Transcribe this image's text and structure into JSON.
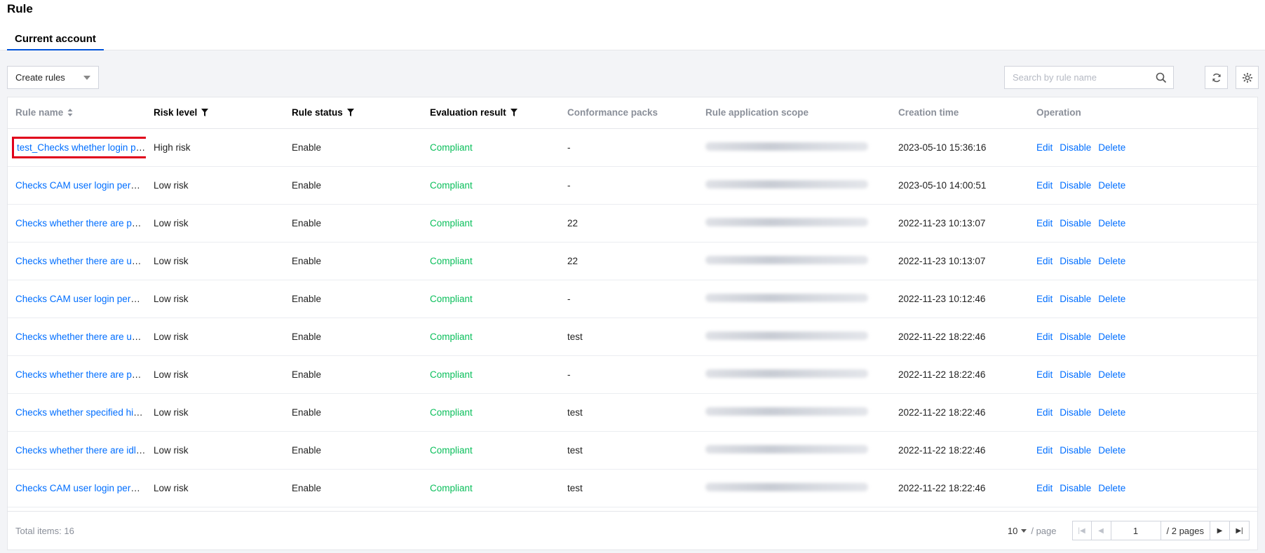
{
  "page": {
    "title": "Rule"
  },
  "tabs": [
    {
      "label": "Current account",
      "active": true
    }
  ],
  "toolbar": {
    "create_label": "Create rules",
    "search_placeholder": "Search by rule name"
  },
  "table": {
    "headers": {
      "rule_name": "Rule name",
      "risk_level": "Risk level",
      "rule_status": "Rule status",
      "evaluation_result": "Evaluation result",
      "conformance_packs": "Conformance packs",
      "scope": "Rule application scope",
      "creation_time": "Creation time",
      "operation": "Operation"
    },
    "operations": {
      "edit": "Edit",
      "disable": "Disable",
      "delete": "Delete"
    },
    "rows": [
      {
        "name": "test_Checks whether login protection MFA is enabl...",
        "risk": "High risk",
        "status": "Enable",
        "result": "Compliant",
        "packs": "-",
        "time": "2023-05-10 15:36:16",
        "highlighted": true
      },
      {
        "name": "Checks CAM user login permissions",
        "risk": "Low risk",
        "status": "Enable",
        "result": "Compliant",
        "packs": "-",
        "time": "2023-05-10 14:00:51"
      },
      {
        "name": "Checks whether there are policies directly authoriz...",
        "risk": "Low risk",
        "status": "Enable",
        "result": "Compliant",
        "packs": "22",
        "time": "2022-11-23 10:13:07"
      },
      {
        "name": "Checks whether there are user groups in CAM",
        "risk": "Low risk",
        "status": "Enable",
        "result": "Compliant",
        "packs": "22",
        "time": "2022-11-23 10:13:07"
      },
      {
        "name": "Checks CAM user login permissions",
        "risk": "Low risk",
        "status": "Enable",
        "result": "Compliant",
        "packs": "-",
        "time": "2022-11-23 10:12:46"
      },
      {
        "name": "Checks whether there are user groups in CAM",
        "risk": "Low risk",
        "status": "Enable",
        "result": "Compliant",
        "packs": "test",
        "time": "2022-11-22 18:22:46"
      },
      {
        "name": "Checks whether there are policies directly authoriz...",
        "risk": "Low risk",
        "status": "Enable",
        "result": "Compliant",
        "packs": "-",
        "time": "2022-11-22 18:22:46"
      },
      {
        "name": "Checks whether specified high-risk permission is a...",
        "risk": "Low risk",
        "status": "Enable",
        "result": "Compliant",
        "packs": "test",
        "time": "2022-11-22 18:22:46"
      },
      {
        "name": "Checks whether there are idle permission policies i...",
        "risk": "Low risk",
        "status": "Enable",
        "result": "Compliant",
        "packs": "test",
        "time": "2022-11-22 18:22:46"
      },
      {
        "name": "Checks CAM user login permissions",
        "risk": "Low risk",
        "status": "Enable",
        "result": "Compliant",
        "packs": "test",
        "time": "2022-11-22 18:22:46"
      }
    ]
  },
  "footer": {
    "total": "Total items: 16",
    "page_size": "10",
    "per_page": "/ page",
    "current_page": "1",
    "pages": "/ 2 pages"
  },
  "colors": {
    "link": "#006eff",
    "compliant": "#0abf5b",
    "highlight": "#e0001b",
    "tab_underline": "#0052d9"
  },
  "icons": [
    "search-icon",
    "refresh-icon",
    "gear-icon",
    "sort-icon",
    "filter-icon",
    "first-page-icon",
    "prev-page-icon",
    "next-page-icon",
    "last-page-icon"
  ]
}
